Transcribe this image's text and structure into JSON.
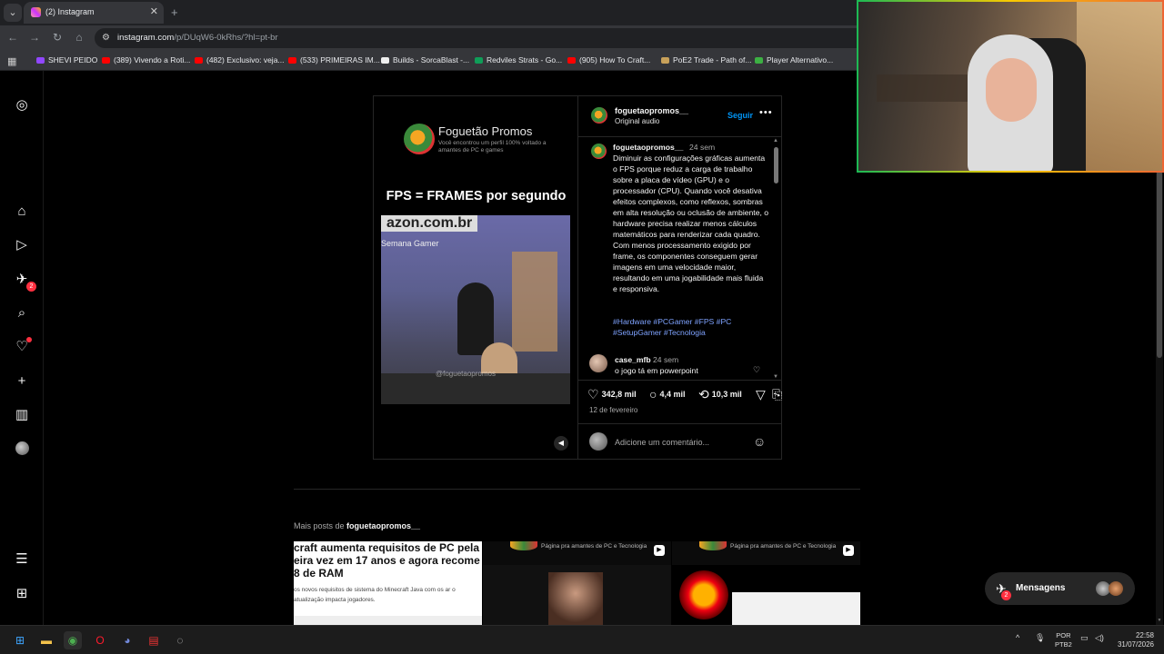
{
  "browser": {
    "tab_title": "(2) Instagram",
    "url_host": "instagram.com",
    "url_path": "/p/DUqW6-0kRhs/?hl=pt-br",
    "bookmarks": [
      {
        "label": "SHEVI PEIDO",
        "color": "#9147ff"
      },
      {
        "label": "(389) Vivendo a Roti...",
        "color": "#ff0000"
      },
      {
        "label": "(482) Exclusivo: veja...",
        "color": "#ff0000"
      },
      {
        "label": "(533) PRIMEIRAS IM...",
        "color": "#ff0000"
      },
      {
        "label": "Builds - SorcaBlast -...",
        "color": "#eeeeee"
      },
      {
        "label": "Redviles Strats - Go...",
        "color": "#0f9d58"
      },
      {
        "label": "(905) How To Craft...",
        "color": "#ff0000"
      },
      {
        "label": "PoE2 Trade - Path of...",
        "color": "#c8a15a"
      },
      {
        "label": "Player Alternativo...",
        "color": "#3cb043"
      }
    ]
  },
  "sidebar": {
    "messages_badge": "2"
  },
  "post": {
    "brand_name": "Foguetão Promos",
    "brand_sub": "Você encontrou um perfil 100% voltado a amantes de PC e games",
    "media_title": "FPS = FRAMES por segundo",
    "video_sign": "azon.com.br",
    "video_sign2": "Semana Gamer",
    "video_watermark": "@foguetaopromos",
    "username": "foguetaopromos__",
    "audio": "Original audio",
    "follow": "Seguir",
    "caption_time": "24 sem",
    "caption": "Diminuir as configurações gráficas aumenta o FPS porque reduz a carga de trabalho sobre a placa de vídeo (GPU) e o processador (CPU). Quando você desativa efeitos complexos, como reflexos, sombras em alta resolução ou oclusão de ambiente, o hardware precisa realizar menos cálculos matemáticos para renderizar cada quadro. Com menos processamento exigido por frame, os componentes conseguem gerar imagens em uma velocidade maior, resultando em uma jogabilidade mais fluida e responsiva.",
    "hashtags": "#Hardware #PCGamer #FPS #PC #SetupGamer #Tecnologia",
    "comment_user": "case_mfb",
    "comment_time": "24 sem",
    "comment_text": "o jogo tá em powerpoint",
    "likes": "342,8 mil",
    "comments": "4,4 mil",
    "reposts": "10,3 mil",
    "date": "12 de fevereiro",
    "comment_placeholder": "Adicione um comentário..."
  },
  "more_posts": {
    "prefix": "Mais posts de",
    "user": "foguetaopromos__",
    "thumb1_headline": "craft aumenta requisitos de PC pela eira vez em 17 anos e agora recome 8 de RAM",
    "thumb1_sub": "os novos requisitos de sistema do Minecraft Java com os ar o atualização impacta jogadores.",
    "thumb_sub": "Página pra amantes de PC e Tecnologia"
  },
  "messages": {
    "label": "Mensagens",
    "badge": "2"
  },
  "taskbar": {
    "lang1": "POR",
    "lang2": "PTB2",
    "time": "22:58",
    "date": "31/07/2026"
  }
}
